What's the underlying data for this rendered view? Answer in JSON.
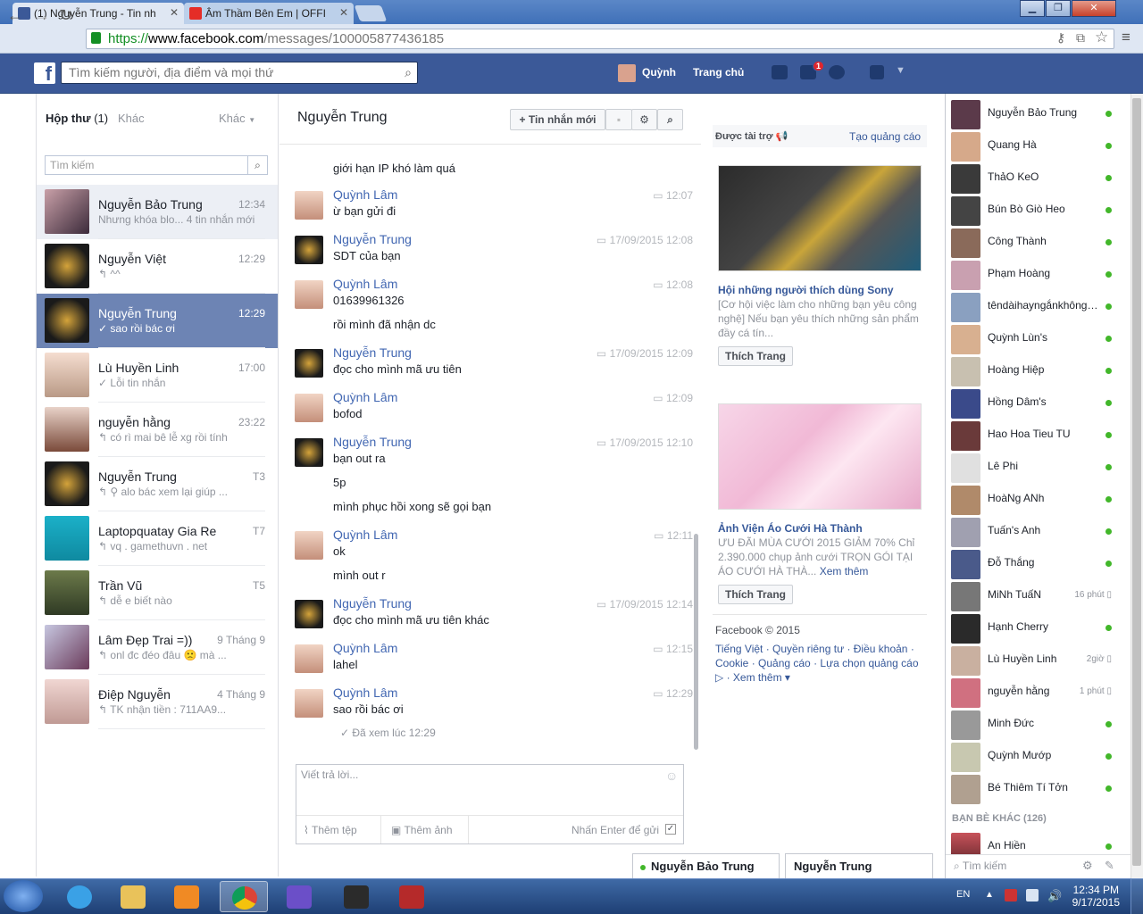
{
  "browser": {
    "tabs": [
      {
        "title": "(1) Nguyễn Trung - Tin nh",
        "active": true
      },
      {
        "title": "Âm Thầm Bên Em | OFFI",
        "active": false
      }
    ],
    "url_scheme": "https://",
    "url_host": "www.facebook.com",
    "url_path": "/messages/100005877436185"
  },
  "fb": {
    "search_placeholder": "Tìm kiếm người, địa điểm và mọi thứ",
    "user_name": "Quỳnh",
    "home_label": "Trang chủ",
    "messages_badge": "1"
  },
  "inbox": {
    "header": "Hộp thư",
    "count": "(1)",
    "other": "Khác",
    "more": "Khác",
    "search_placeholder": "Tìm kiếm",
    "conversations": [
      {
        "name": "Nguyễn Bảo Trung",
        "time": "12:34",
        "snippet": "Nhưng khóa blo...  4 tin nhắn mới",
        "state": "hover"
      },
      {
        "name": "Nguyễn Việt",
        "time": "12:29",
        "snippet": "↰ ^^",
        "state": ""
      },
      {
        "name": "Nguyễn Trung",
        "time": "12:29",
        "snippet": "✓ sao rồi bác ơi",
        "state": "active"
      },
      {
        "name": "Lù Huyền Linh",
        "time": "17:00",
        "snippet": "✓ Lỗi tin nhắn",
        "state": ""
      },
      {
        "name": "nguyễn hằng",
        "time": "23:22",
        "snippet": "↰ có rì mai bê lễ xg rồi tính",
        "state": ""
      },
      {
        "name": "Nguyễn Trung",
        "time": "T3",
        "snippet": "↰ ⚲ alo bác xem lại giúp ...",
        "state": ""
      },
      {
        "name": "Laptopquatay Gia Re",
        "time": "T7",
        "snippet": "↰ vq . gamethuvn . net",
        "state": ""
      },
      {
        "name": "Trần Vũ",
        "time": "T5",
        "snippet": "↰ dễ e biết nào",
        "state": ""
      },
      {
        "name": "Lâm Đẹp Trai =))",
        "time": "9 Tháng 9",
        "snippet": "↰ onl đc đéo đâu 🙁 mà ...",
        "state": ""
      },
      {
        "name": "Điệp Nguyễn",
        "time": "4 Tháng 9",
        "snippet": "↰ TK nhận tiền : 711AA9...",
        "state": ""
      }
    ]
  },
  "conversation": {
    "title": "Nguyễn Trung",
    "new_message_label": "+ Tin nhắn mới",
    "messages": [
      {
        "author": "",
        "time": "",
        "lines": [
          "giới hạn IP khó làm quá"
        ],
        "avatar": ""
      },
      {
        "author": "Quỳnh Lâm",
        "time": "12:07",
        "lines": [
          "ừ bạn gửi đi"
        ],
        "avatar": "quynh"
      },
      {
        "author": "Nguyễn Trung",
        "time": "17/09/2015 12:08",
        "lines": [
          "SDT của bạn"
        ],
        "avatar": "trung"
      },
      {
        "author": "Quỳnh Lâm",
        "time": "12:08",
        "lines": [
          "01639961326",
          "rồi mình đã nhận dc"
        ],
        "avatar": "quynh"
      },
      {
        "author": "Nguyễn Trung",
        "time": "17/09/2015 12:09",
        "lines": [
          "đọc cho mình mã ưu tiên"
        ],
        "avatar": "trung"
      },
      {
        "author": "Quỳnh Lâm",
        "time": "12:09",
        "lines": [
          "bofod"
        ],
        "avatar": "quynh"
      },
      {
        "author": "Nguyễn Trung",
        "time": "17/09/2015 12:10",
        "lines": [
          "bạn out ra",
          "5p",
          "mình phục hồi xong sẽ gọi bạn"
        ],
        "avatar": "trung"
      },
      {
        "author": "Quỳnh Lâm",
        "time": "12:11",
        "lines": [
          "ok",
          "mình out r"
        ],
        "avatar": "quynh"
      },
      {
        "author": "Nguyễn Trung",
        "time": "17/09/2015 12:14",
        "lines": [
          "đọc cho mình mã ưu tiên khác"
        ],
        "avatar": "trung"
      },
      {
        "author": "Quỳnh Lâm",
        "time": "12:15",
        "lines": [
          "lahel"
        ],
        "avatar": "quynh"
      },
      {
        "author": "Quỳnh Lâm",
        "time": "12:29",
        "lines": [
          "sao rồi bác ơi"
        ],
        "avatar": "quynh"
      }
    ],
    "seen": "✓ Đã xem lúc 12:29",
    "reply_placeholder": "Viết trả lời...",
    "add_file": "Thêm tệp",
    "add_photo": "Thêm ảnh",
    "enter_to_send": "Nhấn Enter để gửi"
  },
  "ads": {
    "sponsored": "Được tài trợ",
    "create_ad": "Tạo quảng cáo",
    "items": [
      {
        "title": "Hội những người thích dùng Sony",
        "desc": "[Cơ hội việc làm cho những bạn yêu công nghệ] Nếu bạn yêu thích những sản phẩm đầy cá tín...",
        "like": "Thích Trang"
      },
      {
        "title": "Ảnh Viện Áo Cưới Hà Thành",
        "desc": "  ƯU ĐÃI MÙA CƯỚI 2015 GIẢM 70% Chỉ 2.390.000 chụp ảnh cưới TRỌN GÓI TẠI ÁO CƯỚI HÀ THÀ...",
        "more": "Xem thêm",
        "like": "Thích Trang"
      }
    ],
    "footer_copyright": "Facebook © 2015",
    "footer_links": "Tiếng Việt · Quyền riêng tư · Điều khoản · Cookie · Quảng cáo · Lựa chọn quảng cáo ▷ · Xem thêm ▾"
  },
  "chat": {
    "friends": [
      {
        "name": "Nguyễn Bảo Trung",
        "status": "online"
      },
      {
        "name": "Quang Hà",
        "status": "online"
      },
      {
        "name": "ThảO KeO",
        "status": "online"
      },
      {
        "name": "Bún Bò Giò Heo",
        "status": "online"
      },
      {
        "name": "Công Thành",
        "status": "online"
      },
      {
        "name": "Phạm Hoàng",
        "status": "online"
      },
      {
        "name": "têndàihayngắnkhôngquan...",
        "status": "online"
      },
      {
        "name": "Quỳnh Lùn's",
        "status": "online"
      },
      {
        "name": "Hoàng Hiệp",
        "status": "online"
      },
      {
        "name": "Hồng Dâm's",
        "status": "online"
      },
      {
        "name": "Hao Hoa Tieu TU",
        "status": "online"
      },
      {
        "name": "Lê Phi",
        "status": "online"
      },
      {
        "name": "HoàNg ANh",
        "status": "online"
      },
      {
        "name": "Tuấn's Anh",
        "status": "online"
      },
      {
        "name": "Đỗ Thắng",
        "status": "online"
      },
      {
        "name": "MiNh TuấN",
        "status": "16 phút"
      },
      {
        "name": "Hạnh Cherry",
        "status": "online"
      },
      {
        "name": "Lù Huyền Linh",
        "status": "2giờ"
      },
      {
        "name": "nguyễn hằng",
        "status": "1 phút"
      },
      {
        "name": "Minh Đức",
        "status": "online"
      },
      {
        "name": "Quỳnh Mướp",
        "status": "online"
      },
      {
        "name": "Bé Thiêm Tí Tởn",
        "status": "online"
      }
    ],
    "other_friends": "BẠN BÈ KHÁC (126)",
    "other_first": "An Hiền",
    "search": "Tìm kiếm",
    "open_tabs": [
      "Nguyễn Bảo Trung",
      "Nguyễn Trung"
    ]
  },
  "taskbar": {
    "lang": "EN",
    "time": "12:34 PM",
    "date": "9/17/2015"
  },
  "colors": {
    "fb_blue": "#3b5998",
    "active_conv": "#6d84b4",
    "link": "#4267b2",
    "online": "#42b72a"
  }
}
